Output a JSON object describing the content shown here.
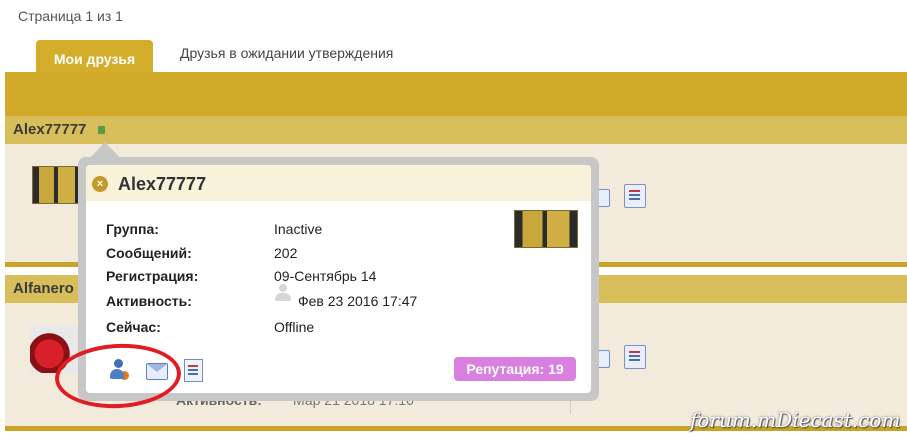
{
  "pager": {
    "text": "Страница 1 из 1"
  },
  "tabs": [
    {
      "label": "Мои друзья",
      "active": true
    },
    {
      "label": "Друзья в ожидании утверждения",
      "active": false
    }
  ],
  "friends": [
    {
      "name": "Alex77777"
    },
    {
      "name": "Alfanero"
    }
  ],
  "background_row": {
    "activity_label": "Активность:",
    "activity_value": "Мар 21 2018 17:16"
  },
  "popup": {
    "title": "Alex77777",
    "fields": [
      {
        "label": "Группа:",
        "value": "Inactive"
      },
      {
        "label": "Сообщений:",
        "value": "202"
      },
      {
        "label": "Регистрация:",
        "value": "09-Сентябрь 14"
      },
      {
        "label": "Активность:",
        "value": "Фев 23 2016 17:47"
      },
      {
        "label": "Сейчас:",
        "value": "Offline"
      }
    ],
    "reputation": "Репутация: 19",
    "close_icon": "close-icon",
    "actions": [
      "user-profile-icon",
      "mail-icon",
      "document-icon"
    ]
  },
  "watermark": "forum.mDiecast.com",
  "colors": {
    "accent": "#d4ad2a",
    "reputation": "#d97fe0",
    "highlight": "#e11d24"
  }
}
